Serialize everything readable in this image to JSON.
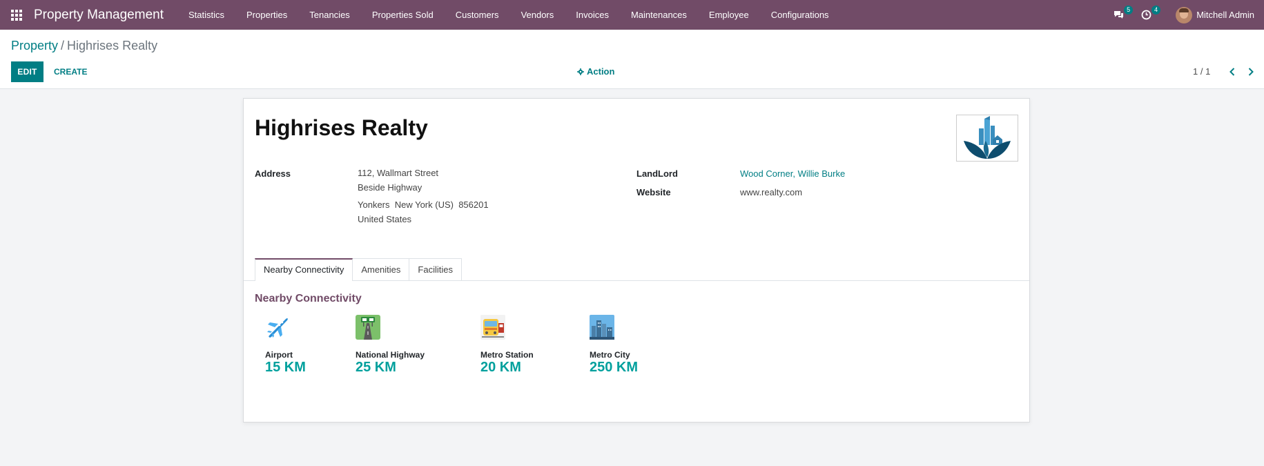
{
  "navbar": {
    "brand": "Property Management",
    "menu": [
      "Statistics",
      "Properties",
      "Tenancies",
      "Properties Sold",
      "Customers",
      "Vendors",
      "Invoices",
      "Maintenances",
      "Employee",
      "Configurations"
    ],
    "messages_badge": "5",
    "activity_badge": "4",
    "user_name": "Mitchell Admin",
    "color": "#714b67"
  },
  "control": {
    "breadcrumb_parent": "Property",
    "breadcrumb_separator": "/",
    "breadcrumb_current": "Highrises Realty",
    "edit_label": "EDIT",
    "create_label": "CREATE",
    "action_label": "Action",
    "pager": "1 / 1"
  },
  "record": {
    "title": "Highrises Realty",
    "address_label": "Address",
    "address_lines": [
      "112, Wallmart Street",
      "Beside Highway",
      "Yonkers  New York (US)  856201",
      "United States"
    ],
    "landlord_label": "LandLord",
    "landlord_value": "Wood Corner, Willie Burke",
    "website_label": "Website",
    "website_value": "www.realty.com"
  },
  "tabs": [
    "Nearby Connectivity",
    "Amenities",
    "Facilities"
  ],
  "active_tab": "Nearby Connectivity",
  "connectivity": {
    "title": "Nearby Connectivity",
    "items": [
      {
        "label": "Airport",
        "value": "15 KM",
        "icon": "airplane-icon"
      },
      {
        "label": "National Highway",
        "value": "25 KM",
        "icon": "highway-icon"
      },
      {
        "label": "Metro Station",
        "value": "20 KM",
        "icon": "metro-train-icon"
      },
      {
        "label": "Metro City",
        "value": "250 KM",
        "icon": "city-skyline-icon"
      }
    ]
  },
  "colors": {
    "accent": "#017e84",
    "brand": "#714b67",
    "value": "#00a09d"
  }
}
